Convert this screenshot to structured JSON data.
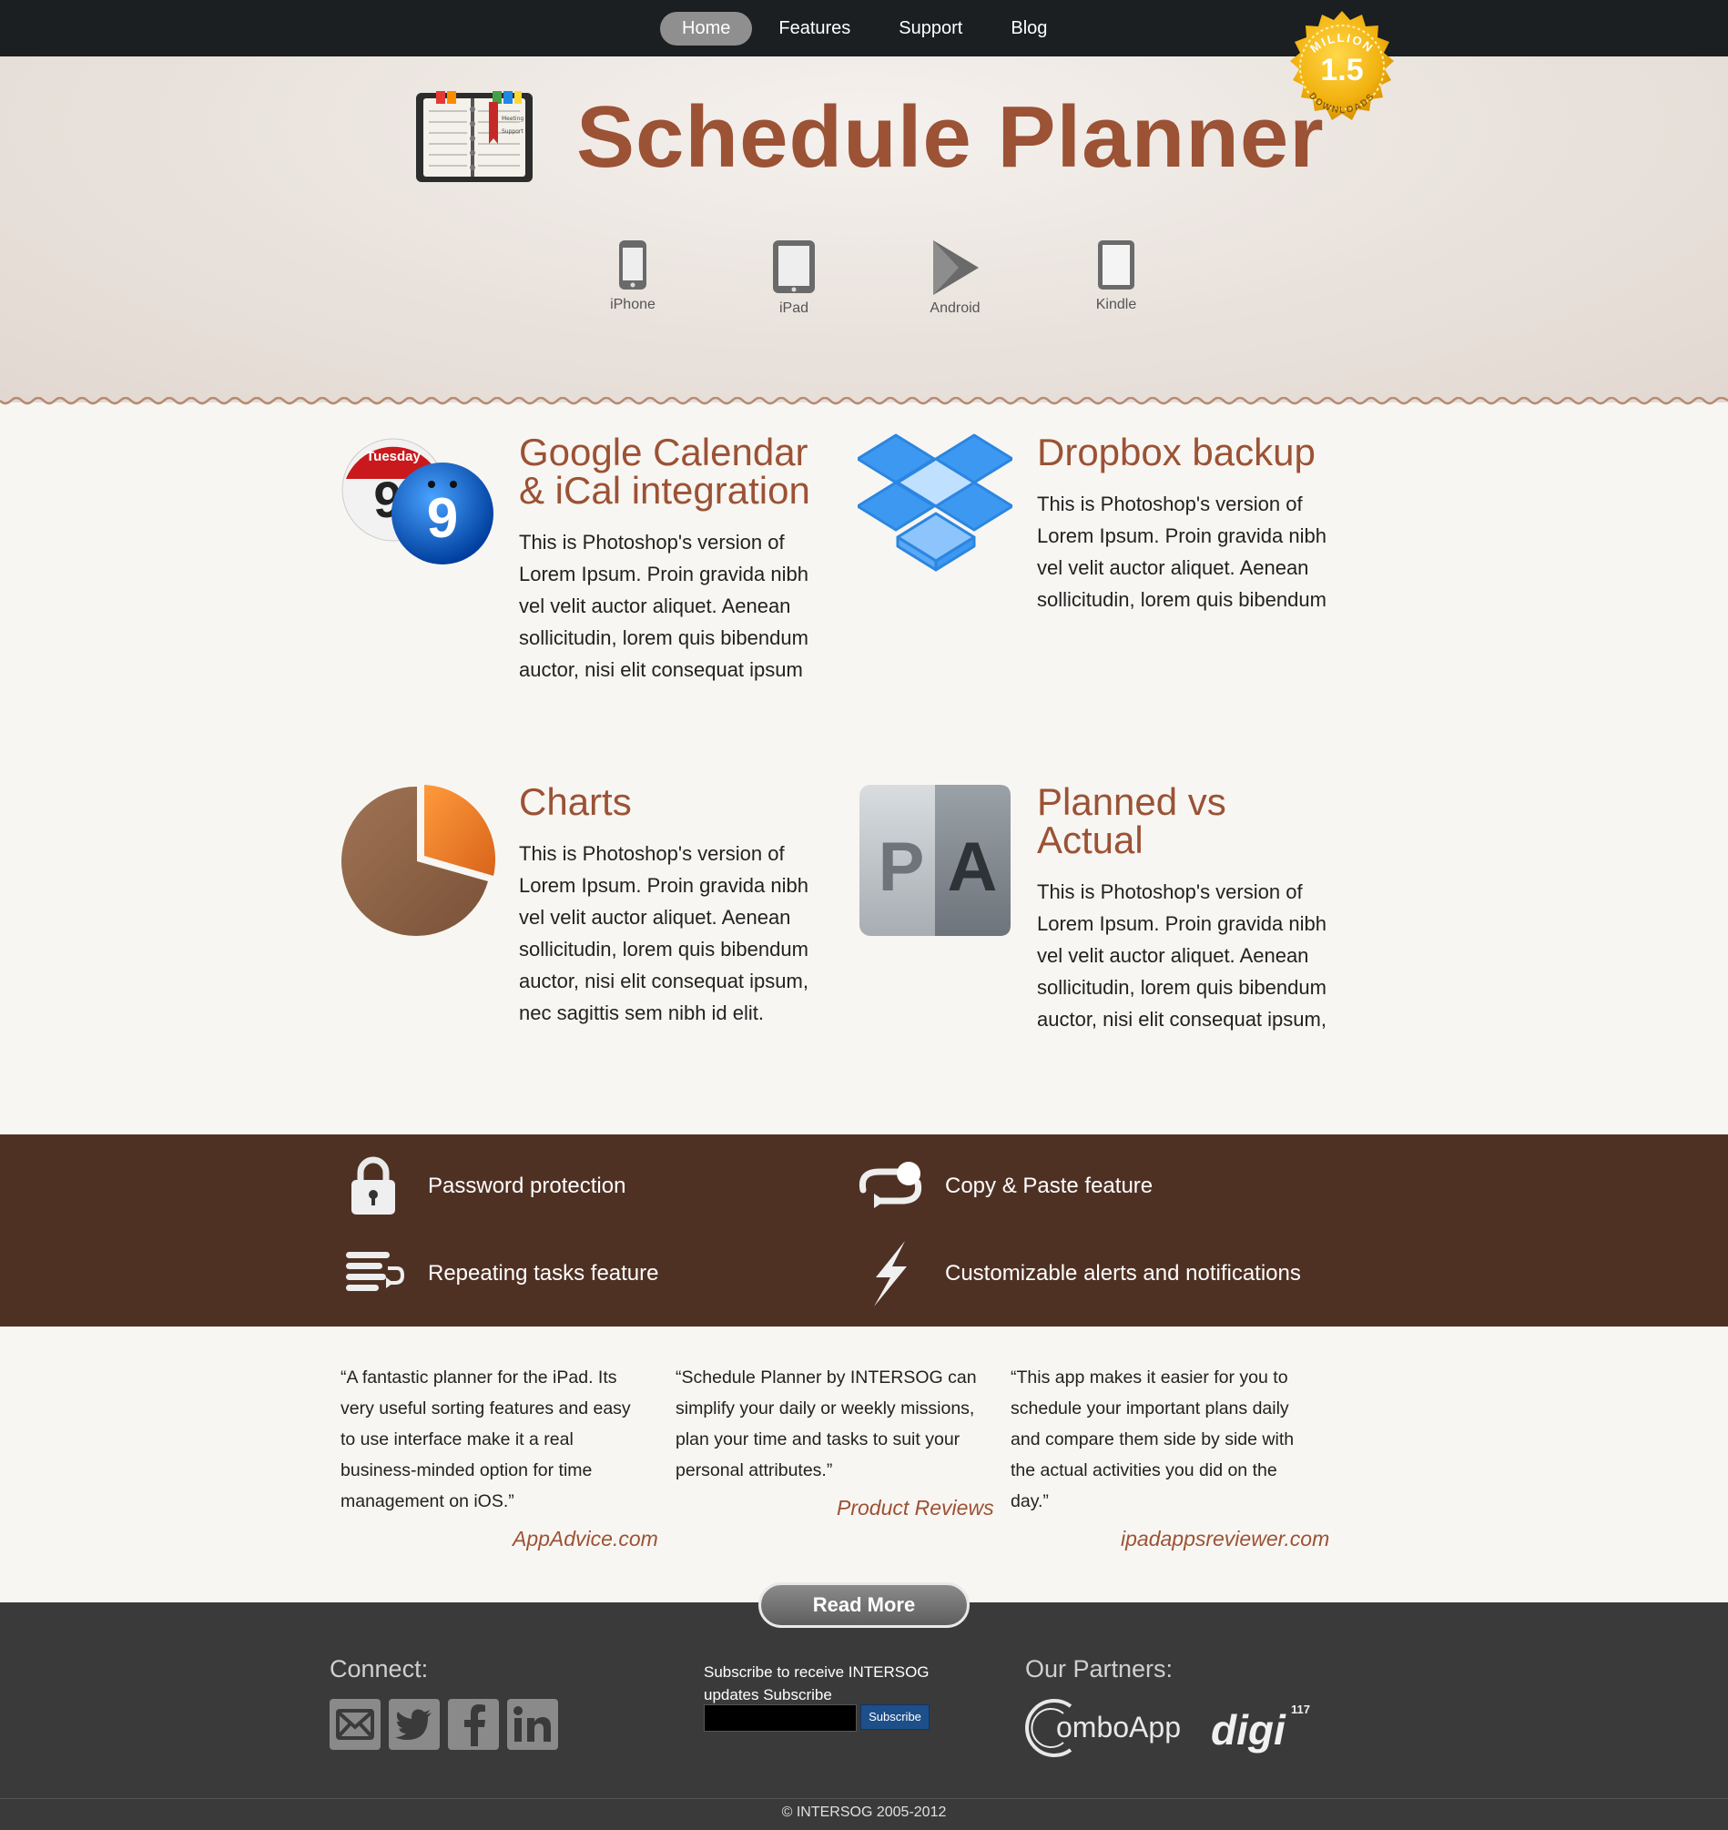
{
  "nav": {
    "items": [
      "Home",
      "Features",
      "Support",
      "Blog"
    ],
    "active": "Home"
  },
  "hero": {
    "title": "Schedule Planner",
    "badge": {
      "top": "MILLION",
      "number": "1.5",
      "bottom": "DOWNLOADS"
    },
    "app_icon_lines": [
      "Meeting",
      "Support"
    ],
    "platforms": [
      {
        "label": "iPhone",
        "icon": "iphone-icon"
      },
      {
        "label": "iPad",
        "icon": "ipad-icon"
      },
      {
        "label": "Android",
        "icon": "android-play-icon"
      },
      {
        "label": "Kindle",
        "icon": "kindle-icon"
      }
    ]
  },
  "features": [
    {
      "title_line1": "Google Calendar",
      "title_line2": "& iCal integration",
      "icon": "calendar-icon",
      "calendar_day": "Tuesday",
      "calendar_date": "9",
      "text": [
        "This is Photoshop's version of",
        "Lorem Ipsum. Proin gravida nibh",
        "vel velit auctor aliquet. Aenean",
        "sollicitudin, lorem quis bibendum",
        "auctor, nisi elit consequat ipsum"
      ]
    },
    {
      "title_line1": "Dropbox backup",
      "title_line2": "",
      "icon": "dropbox-icon",
      "text": [
        "This is Photoshop's version of",
        "Lorem Ipsum. Proin gravida nibh",
        "vel velit auctor aliquet. Aenean",
        "sollicitudin, lorem quis bibendum"
      ]
    },
    {
      "title_line1": "Charts",
      "title_line2": "",
      "icon": "pie-chart-icon",
      "text": [
        "This is Photoshop's version of",
        "Lorem Ipsum. Proin gravida nibh",
        "vel velit auctor aliquet. Aenean",
        "sollicitudin, lorem quis bibendum",
        "auctor, nisi elit consequat ipsum,",
        "nec sagittis sem nibh id elit."
      ]
    },
    {
      "title_line1": "Planned vs",
      "title_line2": "Actual",
      "icon": "planned-actual-icon",
      "icon_letters": [
        "P",
        "A"
      ],
      "text": [
        "This is Photoshop's version of",
        "Lorem Ipsum. Proin gravida nibh",
        "vel velit auctor aliquet. Aenean",
        "sollicitudin, lorem quis bibendum",
        "auctor, nisi elit consequat ipsum,"
      ]
    }
  ],
  "band": [
    {
      "label": "Password protection",
      "icon": "lock-icon"
    },
    {
      "label": "Copy & Paste feature",
      "icon": "copy-paste-icon"
    },
    {
      "label": "Repeating tasks feature",
      "icon": "repeat-list-icon"
    },
    {
      "label": "Customizable alerts and notifications",
      "icon": "lightning-icon"
    }
  ],
  "testimonials": [
    {
      "lines": [
        "“A fantastic planner for the iPad. Its",
        "very useful sorting features and easy",
        "to use interface make it a real",
        "business-minded option for time",
        "management on iOS.”"
      ],
      "source": "AppAdvice.com"
    },
    {
      "lines": [
        "“Schedule Planner by INTERSOG can",
        "simplify your daily or weekly missions,",
        "plan your time and tasks to suit your",
        "personal attributes.”"
      ],
      "source": "Product Reviews"
    },
    {
      "lines": [
        "“This app makes it easier for you to",
        "schedule your important plans daily",
        "and compare them side by side with",
        "the actual activities you did on the",
        "day.”"
      ],
      "source": "ipadappsreviewer.com"
    }
  ],
  "read_more": "Read More",
  "footer": {
    "connect_heading": "Connect:",
    "social": [
      "email-icon",
      "twitter-icon",
      "facebook-icon",
      "linkedin-icon"
    ],
    "subscribe_lines": [
      "Subscribe to receive INTERSOG",
      "updates Subscribe"
    ],
    "subscribe_input_value": "",
    "subscribe_button": "Subscribe",
    "partners_heading": "Our Partners:",
    "partners": [
      {
        "name": "omboApp",
        "icon": "comboapp-logo"
      },
      {
        "name": "digi",
        "superscript": "117",
        "icon": "digi117-logo"
      }
    ],
    "copyright": "© INTERSOG 2005-2012"
  },
  "colors": {
    "accent": "#9b5235",
    "nav_bg": "#1b1f22",
    "band_bg": "#4f3124",
    "footer_bg": "#3a3a3a"
  }
}
